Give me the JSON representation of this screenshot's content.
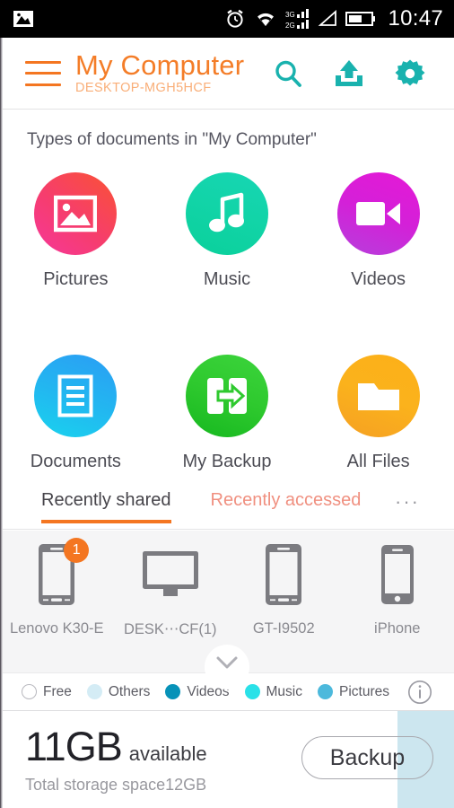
{
  "statusbar": {
    "time": "10:47",
    "icons": [
      "image-icon",
      "alarm-icon",
      "wifi-icon",
      "signal-3g2g-icon",
      "signal-triangle-icon",
      "battery-icon"
    ]
  },
  "header": {
    "menu_icon": "hamburger-icon",
    "title": "My Computer",
    "subtitle": "DESKTOP-MGH5HCF",
    "actions": [
      {
        "name": "search-icon",
        "label": "Search"
      },
      {
        "name": "upload-icon",
        "label": "Upload"
      },
      {
        "name": "gear-icon",
        "label": "Settings"
      }
    ],
    "accent_orange": "#f47621",
    "accent_teal": "#19b8b0"
  },
  "main": {
    "section_label": "Types of documents in \"My Computer\"",
    "categories": [
      {
        "label": "Pictures",
        "icon": "picture-icon",
        "color": "#f84a5c"
      },
      {
        "label": "Music",
        "icon": "music-note-icon",
        "color": "#12d1a5"
      },
      {
        "label": "Videos",
        "icon": "video-cam-icon",
        "color": "#d420d8"
      },
      {
        "label": "Documents",
        "icon": "document-icon",
        "color": "#22b8f0"
      },
      {
        "label": "My Backup",
        "icon": "backup-icon",
        "color": "#2ec92e"
      },
      {
        "label": "All Files",
        "icon": "folder-icon",
        "color": "#fbb21c"
      }
    ]
  },
  "tabs": {
    "items": [
      {
        "label": "Recently shared",
        "active": true
      },
      {
        "label": "Recently accessed",
        "active": false
      }
    ],
    "more_label": "···"
  },
  "devices": [
    {
      "label": "Lenovo K30-E",
      "icon": "android-phone-icon",
      "badge": "1"
    },
    {
      "label": "DESK⋯CF(1)",
      "icon": "desktop-monitor-icon",
      "badge": ""
    },
    {
      "label": "GT-I9502",
      "icon": "android-phone-icon",
      "badge": ""
    },
    {
      "label": "iPhone",
      "icon": "iphone-icon",
      "badge": ""
    }
  ],
  "collapse_handle": {
    "icon": "chevron-down-icon"
  },
  "legend": {
    "items": [
      {
        "label": "Free",
        "color": "#ffffff"
      },
      {
        "label": "Others",
        "color": "#d4ecf5"
      },
      {
        "label": "Videos",
        "color": "#0792b8"
      },
      {
        "label": "Music",
        "color": "#2ae1e8"
      },
      {
        "label": "Pictures",
        "color": "#4cb9dc"
      }
    ],
    "info_icon": "info-icon"
  },
  "storage": {
    "amount": "11GB",
    "amount_unit": "available",
    "total": "Total storage space12GB",
    "backup_button": "Backup",
    "bar_color": "#cce6ef"
  }
}
